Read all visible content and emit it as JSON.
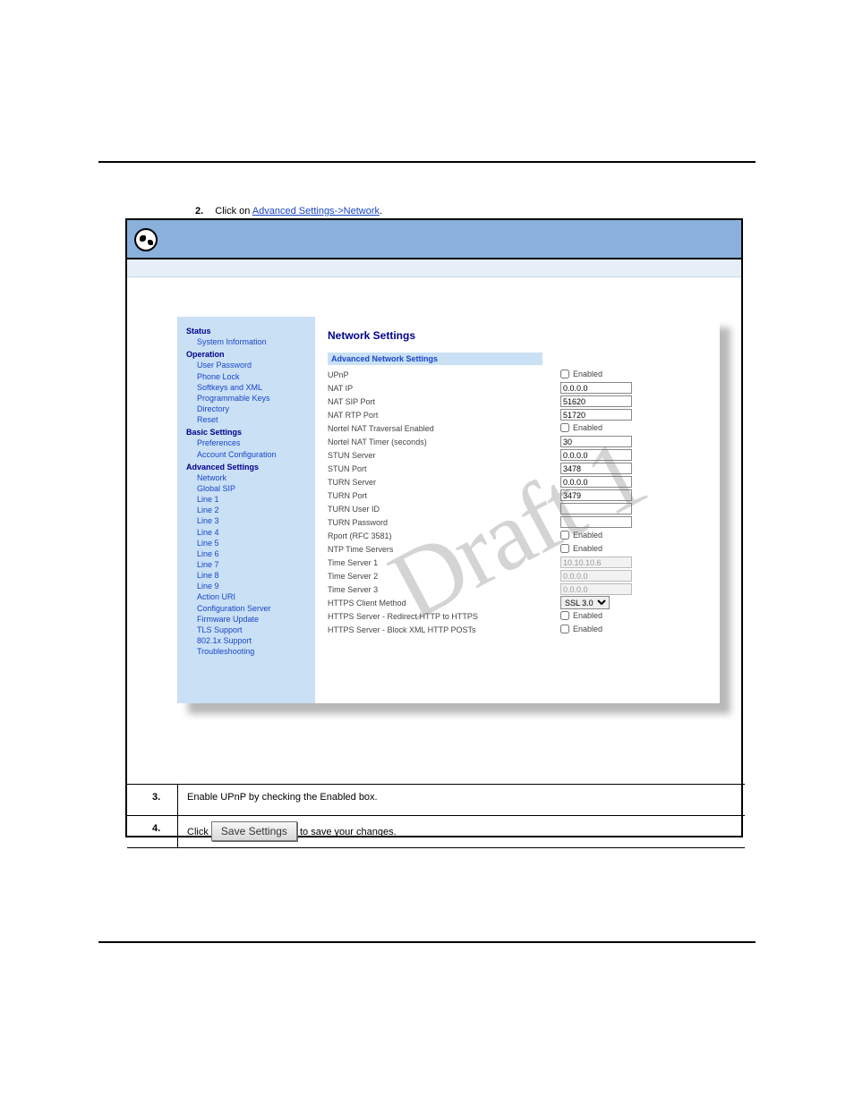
{
  "watermark": "Draft 1",
  "header_right": "",
  "step2": {
    "num": "2.",
    "prefix": "Click on ",
    "link": "Advanced Settings->Network",
    "suffix": "."
  },
  "panel": {
    "sidebar": {
      "groups": [
        {
          "cat": "Status",
          "items": [
            "System Information"
          ]
        },
        {
          "cat": "Operation",
          "items": [
            "User Password",
            "Phone Lock",
            "Softkeys and XML",
            "Programmable Keys",
            "Directory",
            "Reset"
          ]
        },
        {
          "cat": "Basic Settings",
          "items": [
            "Preferences",
            "Account Configuration"
          ]
        },
        {
          "cat": "Advanced Settings",
          "items": [
            "Network",
            "Global SIP",
            "Line 1",
            "Line 2",
            "Line 3",
            "Line 4",
            "Line 5",
            "Line 6",
            "Line 7",
            "Line 8",
            "Line 9",
            "Action URI",
            "Configuration Server",
            "Firmware Update",
            "TLS Support",
            "802.1x Support",
            "Troubleshooting"
          ]
        }
      ]
    },
    "content": {
      "title": "Network Settings",
      "section": "Advanced Network Settings",
      "rows": [
        {
          "label": "UPnP",
          "type": "checkbox",
          "text": "Enabled",
          "checked": false
        },
        {
          "label": "NAT IP",
          "type": "text",
          "value": "0.0.0.0"
        },
        {
          "label": "NAT SIP Port",
          "type": "text",
          "value": "51620"
        },
        {
          "label": "NAT RTP Port",
          "type": "text",
          "value": "51720"
        },
        {
          "label": "Nortel NAT Traversal Enabled",
          "type": "checkbox",
          "text": "Enabled",
          "checked": false
        },
        {
          "label": "Nortel NAT Timer (seconds)",
          "type": "text",
          "value": "30"
        },
        {
          "label": "STUN Server",
          "type": "text",
          "value": "0.0.0.0"
        },
        {
          "label": "STUN Port",
          "type": "text",
          "value": "3478"
        },
        {
          "label": "TURN Server",
          "type": "text",
          "value": "0.0.0.0"
        },
        {
          "label": "TURN Port",
          "type": "text",
          "value": "3479"
        },
        {
          "label": "TURN User ID",
          "type": "text",
          "value": ""
        },
        {
          "label": "TURN Password",
          "type": "text",
          "value": ""
        },
        {
          "label": "Rport (RFC 3581)",
          "type": "checkbox",
          "text": "Enabled",
          "checked": false
        },
        {
          "label": "NTP Time Servers",
          "type": "checkbox",
          "text": "Enabled",
          "checked": false
        },
        {
          "label": "Time Server 1",
          "type": "text",
          "value": "10.10.10.6",
          "disabled": true
        },
        {
          "label": "Time Server 2",
          "type": "text",
          "value": "0.0.0.0",
          "disabled": true
        },
        {
          "label": "Time Server 3",
          "type": "text",
          "value": "0.0.0.0",
          "disabled": true
        },
        {
          "label": "HTTPS Client Method",
          "type": "select",
          "value": "SSL 3.0"
        },
        {
          "label": "HTTPS Server - Redirect HTTP to HTTPS",
          "type": "checkbox",
          "text": "Enabled",
          "checked": false
        },
        {
          "label": "HTTPS Server - Block XML HTTP POSTs",
          "type": "checkbox",
          "text": "Enabled",
          "checked": false
        }
      ]
    }
  },
  "step3a": {
    "num": "3.",
    "text": "Enable UPnP by checking the Enabled box."
  },
  "step3b": {
    "num": "4.",
    "text": "Click "
  },
  "save_button": "Save Settings",
  "save_suffix": " to save your changes."
}
